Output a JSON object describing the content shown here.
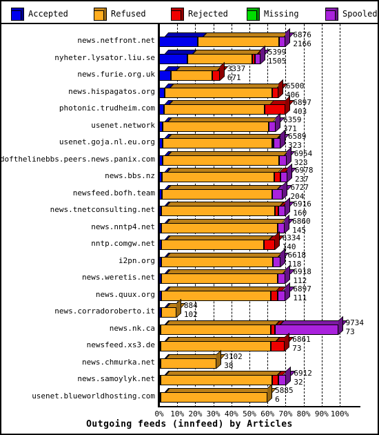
{
  "chart_data": {
    "type": "bar",
    "orientation": "horizontal",
    "stacked": true,
    "percent": true,
    "title": "Outgoing feeds (innfeed) by Articles",
    "xlabel": "Outgoing feeds (innfeed) by Articles",
    "ylabel": "",
    "xlim": [
      0,
      100
    ],
    "xticks": [
      "0%",
      "10%",
      "20%",
      "30%",
      "40%",
      "50%",
      "60%",
      "70%",
      "80%",
      "90%",
      "100%"
    ],
    "grid": true,
    "legend_position": "top",
    "legend": [
      {
        "name": "Accepted",
        "color": "#0000ee"
      },
      {
        "name": "Refused",
        "color": "#ffad20"
      },
      {
        "name": "Rejected",
        "color": "#ee0000"
      },
      {
        "name": "Missing",
        "color": "#00dd00"
      },
      {
        "name": "Spooled",
        "color": "#aa22dd"
      }
    ],
    "series": [
      {
        "name": "Accepted",
        "color": "#0000ee"
      },
      {
        "name": "Refused",
        "color": "#ffad20"
      },
      {
        "name": "Rejected",
        "color": "#ee0000"
      },
      {
        "name": "Missing",
        "color": "#00dd00"
      },
      {
        "name": "Spooled",
        "color": "#aa22dd"
      }
    ],
    "categories": [
      "news.netfront.net",
      "nyheter.lysator.liu.se",
      "news.furie.org.uk",
      "news.hispagatos.org",
      "photonic.trudheim.com",
      "usenet.network",
      "usenet.goja.nl.eu.org",
      "endofthelinebbs.peers.news.panix.com",
      "news.bbs.nz",
      "newsfeed.bofh.team",
      "news.tnetconsulting.net",
      "news.nntp4.net",
      "nntp.comgw.net",
      "i2pn.org",
      "news.weretis.net",
      "news.quux.org",
      "news.corradoroberto.it",
      "news.nk.ca",
      "newsfeed.xs3.de",
      "news.chmurka.net",
      "news.samoylyk.net",
      "usenet.blueworldhosting.com"
    ],
    "rows": [
      {
        "category": "news.netfront.net",
        "total_label": "6876",
        "value_label": "2166",
        "bar_pct": 70.0,
        "segments": [
          {
            "series": "Accepted",
            "pct": 21.5
          },
          {
            "series": "Refused",
            "pct": 45.0
          },
          {
            "series": "Spooled",
            "pct": 3.5
          }
        ]
      },
      {
        "category": "nyheter.lysator.liu.se",
        "total_label": "5399",
        "value_label": "1505",
        "bar_pct": 56.0,
        "segments": [
          {
            "series": "Accepted",
            "pct": 15.5
          },
          {
            "series": "Refused",
            "pct": 36.0
          },
          {
            "series": "Rejected",
            "pct": 1.5
          },
          {
            "series": "Spooled",
            "pct": 3.0
          }
        ]
      },
      {
        "category": "news.furie.org.uk",
        "total_label": "3337",
        "value_label": "671",
        "bar_pct": 33.5,
        "segments": [
          {
            "series": "Accepted",
            "pct": 6.5
          },
          {
            "series": "Refused",
            "pct": 23.0
          },
          {
            "series": "Rejected",
            "pct": 4.0
          }
        ]
      },
      {
        "category": "news.hispagatos.org",
        "total_label": "6500",
        "value_label": "406",
        "bar_pct": 66.0,
        "segments": [
          {
            "series": "Accepted",
            "pct": 3.0
          },
          {
            "series": "Refused",
            "pct": 59.5
          },
          {
            "series": "Rejected",
            "pct": 3.5
          }
        ]
      },
      {
        "category": "photonic.trudheim.com",
        "total_label": "6897",
        "value_label": "403",
        "bar_pct": 70.0,
        "segments": [
          {
            "series": "Accepted",
            "pct": 2.5
          },
          {
            "series": "Refused",
            "pct": 56.0
          },
          {
            "series": "Rejected",
            "pct": 11.5
          }
        ]
      },
      {
        "category": "usenet.network",
        "total_label": "6359",
        "value_label": "371",
        "bar_pct": 64.5,
        "segments": [
          {
            "series": "Accepted",
            "pct": 2.0
          },
          {
            "series": "Refused",
            "pct": 58.5
          },
          {
            "series": "Spooled",
            "pct": 4.0
          }
        ]
      },
      {
        "category": "usenet.goja.nl.eu.org",
        "total_label": "6589",
        "value_label": "323",
        "bar_pct": 67.0,
        "segments": [
          {
            "series": "Accepted",
            "pct": 2.0
          },
          {
            "series": "Refused",
            "pct": 60.5
          },
          {
            "series": "Rejected",
            "pct": 0.6
          },
          {
            "series": "Spooled",
            "pct": 3.9
          }
        ]
      },
      {
        "category": "endofthelinebbs.peers.news.panix.com",
        "total_label": "6954",
        "value_label": "323",
        "bar_pct": 70.5,
        "segments": [
          {
            "series": "Accepted",
            "pct": 2.0
          },
          {
            "series": "Refused",
            "pct": 64.5
          },
          {
            "series": "Spooled",
            "pct": 4.0
          }
        ]
      },
      {
        "category": "news.bbs.nz",
        "total_label": "6978",
        "value_label": "237",
        "bar_pct": 71.0,
        "segments": [
          {
            "series": "Accepted",
            "pct": 1.7
          },
          {
            "series": "Refused",
            "pct": 62.0
          },
          {
            "series": "Rejected",
            "pct": 3.3
          },
          {
            "series": "Spooled",
            "pct": 4.0
          }
        ]
      },
      {
        "category": "newsfeed.bofh.team",
        "total_label": "6727",
        "value_label": "204",
        "bar_pct": 68.5,
        "segments": [
          {
            "series": "Accepted",
            "pct": 1.5
          },
          {
            "series": "Refused",
            "pct": 61.0
          },
          {
            "series": "Spooled",
            "pct": 6.0
          }
        ]
      },
      {
        "category": "news.tnetconsulting.net",
        "total_label": "6916",
        "value_label": "160",
        "bar_pct": 70.0,
        "segments": [
          {
            "series": "Accepted",
            "pct": 1.2
          },
          {
            "series": "Refused",
            "pct": 63.0
          },
          {
            "series": "Rejected",
            "pct": 1.8
          },
          {
            "series": "Spooled",
            "pct": 4.0
          }
        ]
      },
      {
        "category": "news.nntp4.net",
        "total_label": "6860",
        "value_label": "145",
        "bar_pct": 69.5,
        "segments": [
          {
            "series": "Accepted",
            "pct": 1.2
          },
          {
            "series": "Refused",
            "pct": 64.3
          },
          {
            "series": "Spooled",
            "pct": 4.0
          }
        ]
      },
      {
        "category": "nntp.comgw.net",
        "total_label": "6334",
        "value_label": "140",
        "bar_pct": 64.0,
        "segments": [
          {
            "series": "Accepted",
            "pct": 1.2
          },
          {
            "series": "Refused",
            "pct": 56.8
          },
          {
            "series": "Rejected",
            "pct": 6.0
          }
        ]
      },
      {
        "category": "i2pn.org",
        "total_label": "6618",
        "value_label": "118",
        "bar_pct": 67.0,
        "segments": [
          {
            "series": "Accepted",
            "pct": 1.0
          },
          {
            "series": "Refused",
            "pct": 62.0
          },
          {
            "series": "Spooled",
            "pct": 4.0
          }
        ]
      },
      {
        "category": "news.weretis.net",
        "total_label": "6918",
        "value_label": "112",
        "bar_pct": 70.0,
        "segments": [
          {
            "series": "Accepted",
            "pct": 1.0
          },
          {
            "series": "Refused",
            "pct": 64.5
          },
          {
            "series": "Spooled",
            "pct": 4.5
          }
        ]
      },
      {
        "category": "news.quux.org",
        "total_label": "6897",
        "value_label": "111",
        "bar_pct": 70.0,
        "segments": [
          {
            "series": "Accepted",
            "pct": 1.0
          },
          {
            "series": "Refused",
            "pct": 61.0
          },
          {
            "series": "Rejected",
            "pct": 3.5
          },
          {
            "series": "Spooled",
            "pct": 4.5
          }
        ]
      },
      {
        "category": "news.corradoroberto.it",
        "total_label": "884",
        "value_label": "102",
        "bar_pct": 9.5,
        "segments": [
          {
            "series": "Accepted",
            "pct": 1.0
          },
          {
            "series": "Refused",
            "pct": 8.5
          }
        ]
      },
      {
        "category": "news.nk.ca",
        "total_label": "9734",
        "value_label": "73",
        "bar_pct": 99.0,
        "segments": [
          {
            "series": "Accepted",
            "pct": 0.7
          },
          {
            "series": "Refused",
            "pct": 61.0
          },
          {
            "series": "Rejected",
            "pct": 2.3
          },
          {
            "series": "Spooled",
            "pct": 35.0
          }
        ]
      },
      {
        "category": "newsfeed.xs3.de",
        "total_label": "6861",
        "value_label": "73",
        "bar_pct": 69.5,
        "segments": [
          {
            "series": "Accepted",
            "pct": 0.7
          },
          {
            "series": "Refused",
            "pct": 61.0
          },
          {
            "series": "Rejected",
            "pct": 7.8
          }
        ]
      },
      {
        "category": "news.chmurka.net",
        "total_label": "3102",
        "value_label": "38",
        "bar_pct": 31.5,
        "segments": [
          {
            "series": "Accepted",
            "pct": 0.5
          },
          {
            "series": "Refused",
            "pct": 31.0
          }
        ]
      },
      {
        "category": "news.samoylyk.net",
        "total_label": "6912",
        "value_label": "32",
        "bar_pct": 70.0,
        "segments": [
          {
            "series": "Accepted",
            "pct": 0.4
          },
          {
            "series": "Refused",
            "pct": 62.0
          },
          {
            "series": "Rejected",
            "pct": 3.1
          },
          {
            "series": "Spooled",
            "pct": 4.5
          }
        ]
      },
      {
        "category": "usenet.blueworldhosting.com",
        "total_label": "5885",
        "value_label": "6",
        "bar_pct": 59.5,
        "segments": [
          {
            "series": "Accepted",
            "pct": 0.3
          },
          {
            "series": "Refused",
            "pct": 59.2
          }
        ]
      }
    ]
  }
}
